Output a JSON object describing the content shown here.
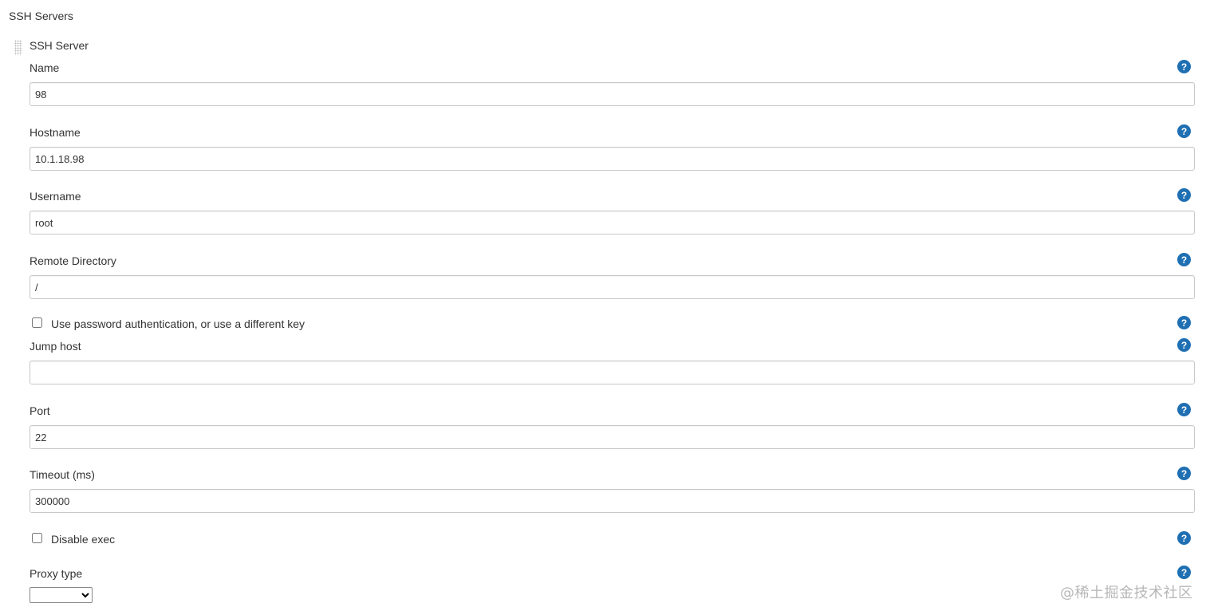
{
  "section": {
    "title": "SSH Servers"
  },
  "server": {
    "title": "SSH Server",
    "grip_icon": "drag-handle-icon"
  },
  "fields": {
    "name": {
      "label": "Name",
      "value": "98"
    },
    "hostname": {
      "label": "Hostname",
      "value": "10.1.18.98"
    },
    "username": {
      "label": "Username",
      "value": "root"
    },
    "remote_directory": {
      "label": "Remote Directory",
      "value": "/"
    },
    "use_password": {
      "label": "Use password authentication, or use a different key",
      "checked": false
    },
    "jump_host": {
      "label": "Jump host",
      "value": ""
    },
    "port": {
      "label": "Port",
      "value": "22"
    },
    "timeout": {
      "label": "Timeout (ms)",
      "value": "300000"
    },
    "disable_exec": {
      "label": "Disable exec",
      "checked": false
    },
    "proxy_type": {
      "label": "Proxy type",
      "selected": ""
    }
  },
  "help": {
    "glyph": "?",
    "icon": "help-icon",
    "color": "#1f6fb3"
  },
  "watermark": {
    "text": "@稀土掘金技术社区"
  }
}
